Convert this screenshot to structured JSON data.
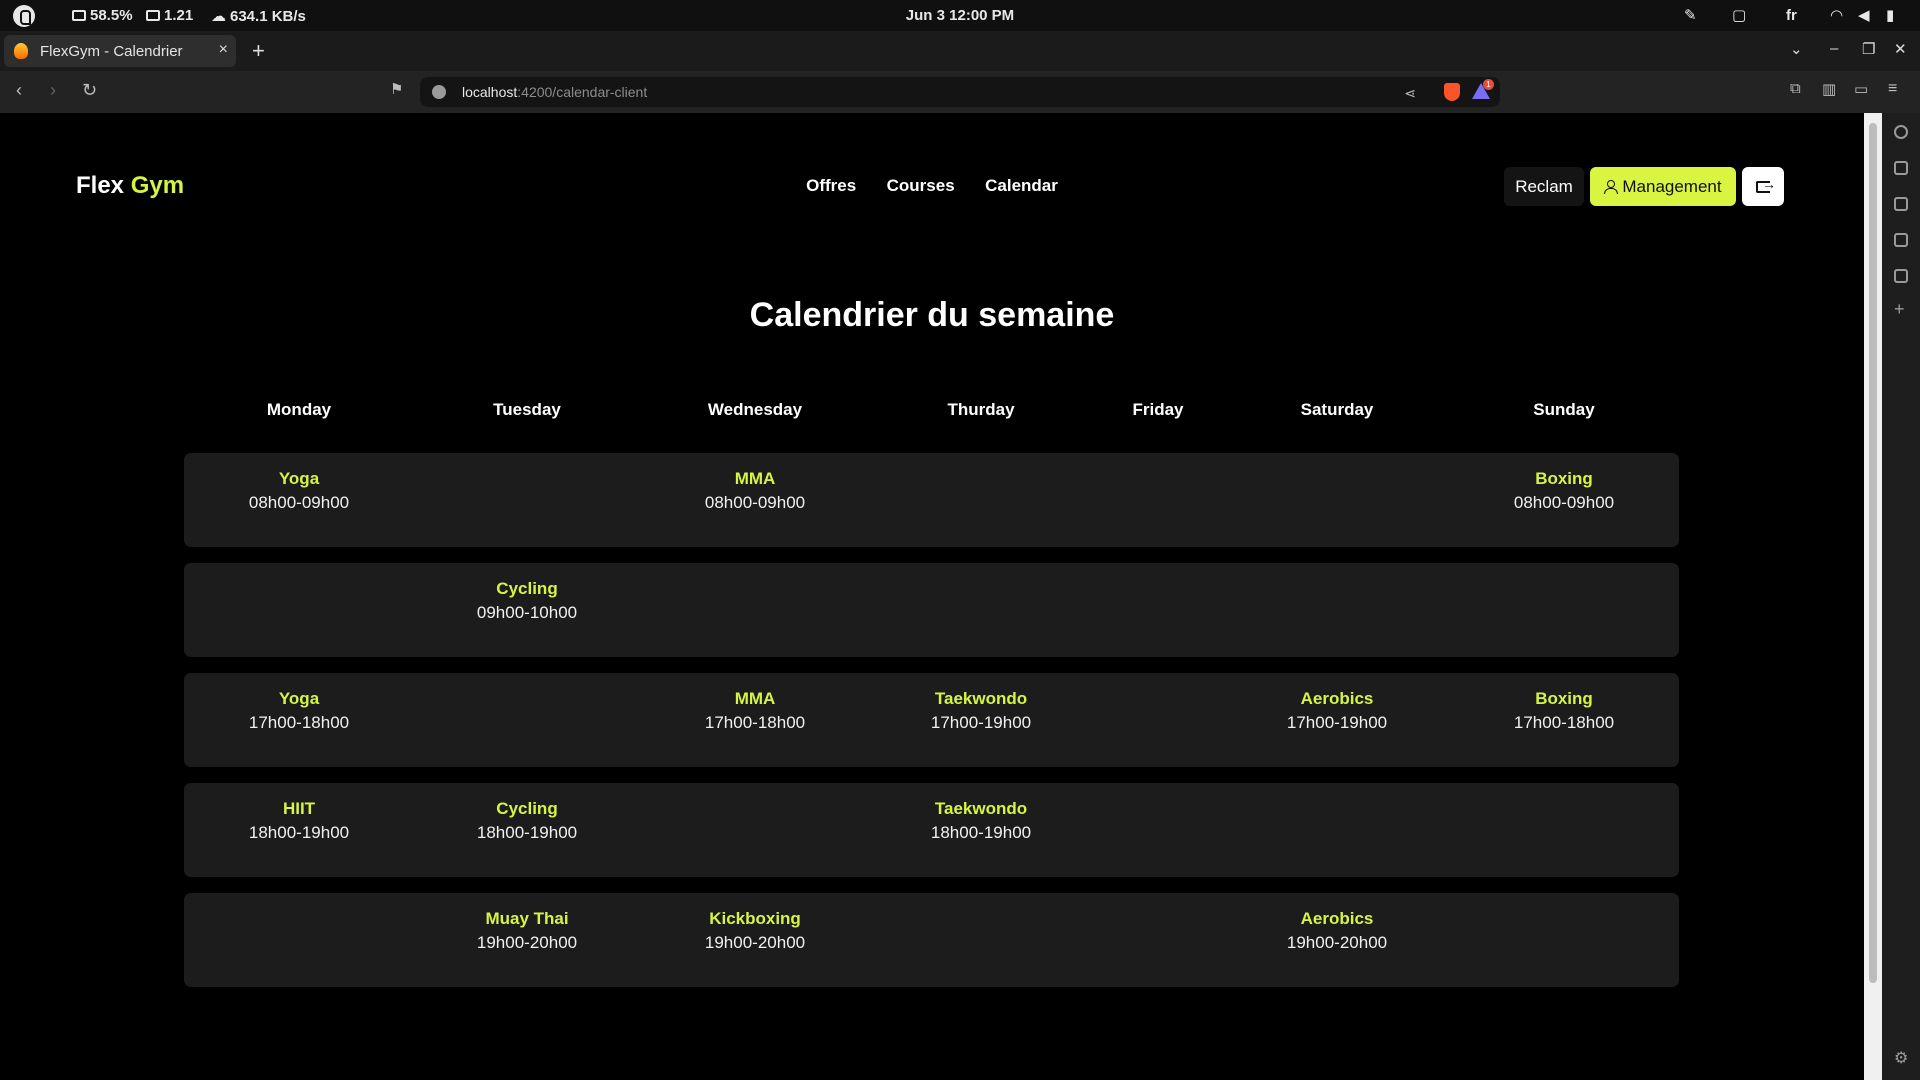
{
  "os": {
    "battery_stat": "58.5%",
    "load_stat": "1.21",
    "net_stat": "634.1 KB/s",
    "datetime": "Jun 3  12:00 PM",
    "lang": "fr"
  },
  "browser": {
    "tab_title": "FlexGym - Calendrier",
    "url_host": "localhost",
    "url_path": ":4200/calendar-client",
    "notif_count": "1"
  },
  "brand": {
    "first": "Flex",
    "second": "Gym",
    "accent_color": "#d4f542"
  },
  "nav": {
    "items": [
      "Offres",
      "Courses",
      "Calendar"
    ]
  },
  "actions": {
    "reclam": "Reclam",
    "management": "Management"
  },
  "page_title": "Calendrier du semaine",
  "days": [
    "Monday",
    "Tuesday",
    "Wednesday",
    "Thurday",
    "Friday",
    "Saturday",
    "Sunday"
  ],
  "rows": [
    {
      "slots": [
        {
          "day": 0,
          "name": "Yoga",
          "time": "08h00-09h00"
        },
        {
          "day": 2,
          "name": "MMA",
          "time": "08h00-09h00"
        },
        {
          "day": 6,
          "name": "Boxing",
          "time": "08h00-09h00"
        }
      ]
    },
    {
      "slots": [
        {
          "day": 1,
          "name": "Cycling",
          "time": "09h00-10h00"
        }
      ]
    },
    {
      "slots": [
        {
          "day": 0,
          "name": "Yoga",
          "time": "17h00-18h00"
        },
        {
          "day": 2,
          "name": "MMA",
          "time": "17h00-18h00"
        },
        {
          "day": 3,
          "name": "Taekwondo",
          "time": "17h00-19h00"
        },
        {
          "day": 5,
          "name": "Aerobics",
          "time": "17h00-19h00"
        },
        {
          "day": 6,
          "name": "Boxing",
          "time": "17h00-18h00"
        }
      ]
    },
    {
      "slots": [
        {
          "day": 0,
          "name": "HIIT",
          "time": "18h00-19h00"
        },
        {
          "day": 1,
          "name": "Cycling",
          "time": "18h00-19h00"
        },
        {
          "day": 3,
          "name": "Taekwondo",
          "time": "18h00-19h00"
        }
      ]
    },
    {
      "slots": [
        {
          "day": 1,
          "name": "Muay Thai",
          "time": "19h00-20h00"
        },
        {
          "day": 2,
          "name": "Kickboxing",
          "time": "19h00-20h00"
        },
        {
          "day": 5,
          "name": "Aerobics",
          "time": "19h00-20h00"
        }
      ]
    }
  ]
}
